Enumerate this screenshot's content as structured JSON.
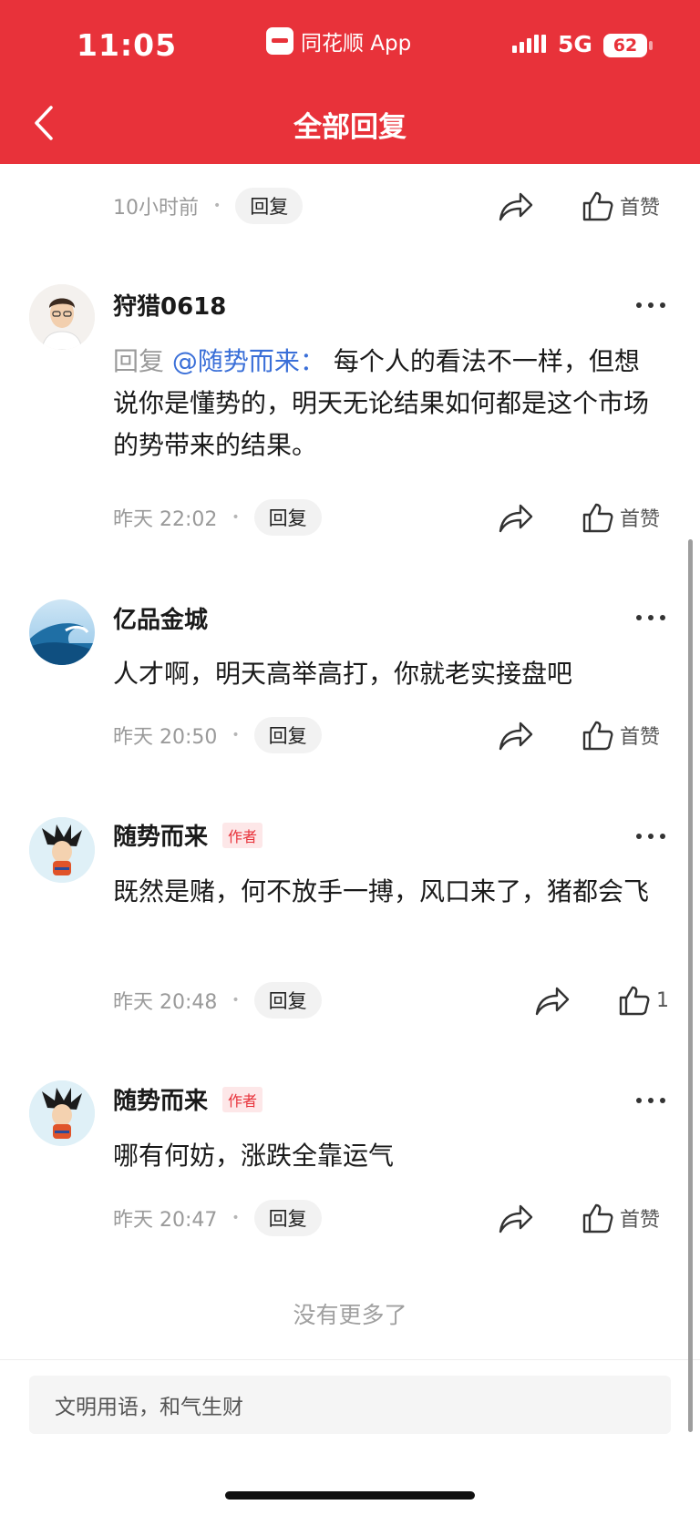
{
  "status_bar": {
    "time": "11:05",
    "app_label": "同花顺 App",
    "network": "5G",
    "battery": "62"
  },
  "header": {
    "title": "全部回复"
  },
  "top_row": {
    "time": "10小时前",
    "reply_label": "回复",
    "like_label": "首赞"
  },
  "comments": [
    {
      "username": "狩猎0618",
      "author_tag": "",
      "reply_prefix": "回复",
      "mention": "@随势而来：",
      "text": "每个人的看法不一样，但想说你是懂势的，明天无论结果如何都是这个市场的势带来的结果。",
      "time": "昨天 22:02",
      "reply_label": "回复",
      "like_label": "首赞"
    },
    {
      "username": "亿品金城",
      "author_tag": "",
      "text": "人才啊，明天高举高打，你就老实接盘吧",
      "time": "昨天 20:50",
      "reply_label": "回复",
      "like_label": "首赞"
    },
    {
      "username": "随势而来",
      "author_tag": "作者",
      "text": "既然是赌，何不放手一搏，风口来了，猪都会飞",
      "time": "昨天 20:48",
      "reply_label": "回复",
      "like_label": "1"
    },
    {
      "username": "随势而来",
      "author_tag": "作者",
      "text": "哪有何妨，涨跌全靠运气",
      "time": "昨天 20:47",
      "reply_label": "回复",
      "like_label": "首赞"
    }
  ],
  "footer": {
    "no_more": "没有更多了",
    "input_placeholder": "文明用语，和气生财"
  },
  "colors": {
    "brand_red": "#e8323a",
    "mention_blue": "#3a6fd8",
    "muted_gray": "#9a9a9a"
  },
  "icons": [
    "back-arrow-icon",
    "share-icon",
    "thumbs-up-icon",
    "more-dots-icon"
  ]
}
